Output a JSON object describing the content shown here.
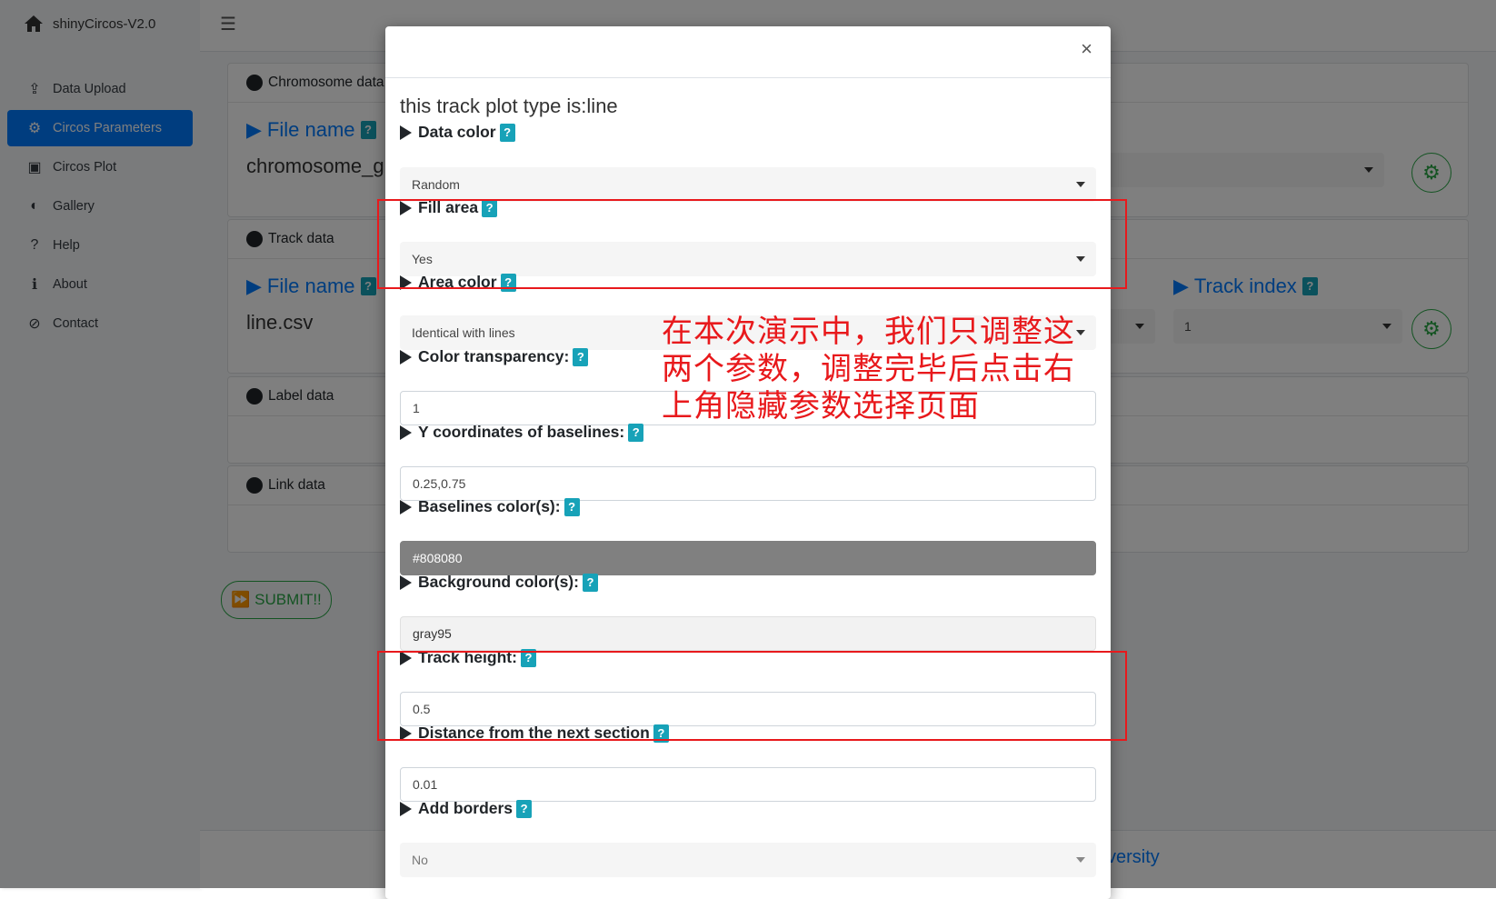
{
  "app": {
    "title": "shinyCircos-V2.0"
  },
  "sidebar": {
    "items": [
      {
        "label": "Data Upload",
        "icon": "upload-icon"
      },
      {
        "label": "Circos Parameters",
        "icon": "gears-icon"
      },
      {
        "label": "Circos Plot",
        "icon": "image-icon"
      },
      {
        "label": "Gallery",
        "icon": "adjust-icon"
      },
      {
        "label": "Help",
        "icon": "question-icon"
      },
      {
        "label": "About",
        "icon": "info-icon"
      },
      {
        "label": "Contact",
        "icon": "compass-icon"
      }
    ],
    "active_index": 1
  },
  "background": {
    "sections": {
      "chromosome": "Chromosome data",
      "track": "Track data",
      "label": "Label data",
      "link": "Link data"
    },
    "file_name_label": "File name",
    "chromosome_file": "chromosome_g",
    "track_file": "line.csv",
    "track_index_label": "Track index",
    "track_index_value": "1",
    "submit_label": "SUBMIT!!",
    "footer_link_text": "versity"
  },
  "modal": {
    "close_symbol": "×",
    "title": "this track plot type is:line",
    "help_symbol": "?",
    "fields": {
      "data_color": {
        "label": "Data color",
        "value": "Random"
      },
      "fill_area": {
        "label": "Fill area",
        "value": "Yes"
      },
      "area_color": {
        "label": "Area color",
        "value": "Identical with lines"
      },
      "color_transparency": {
        "label": "Color transparency:",
        "value": "1"
      },
      "y_baselines": {
        "label": "Y coordinates of baselines:",
        "value": "0.25,0.75"
      },
      "baselines_color": {
        "label": "Baselines color(s):",
        "value": "#808080"
      },
      "background_color": {
        "label": "Background color(s):",
        "value": "gray95"
      },
      "track_height": {
        "label": "Track height:",
        "value": "0.5"
      },
      "distance_next": {
        "label": "Distance from the next section",
        "value": "0.01"
      },
      "add_borders": {
        "label": "Add borders",
        "value": "No"
      }
    }
  },
  "annotation": {
    "text": "在本次演示中，我们只调整这两个参数，调整完毕后点击右上角隐藏参数选择页面",
    "color": "#e8191c"
  },
  "colors": {
    "primary": "#007bff",
    "success": "#28a745",
    "help_badge": "#17a2b8"
  }
}
